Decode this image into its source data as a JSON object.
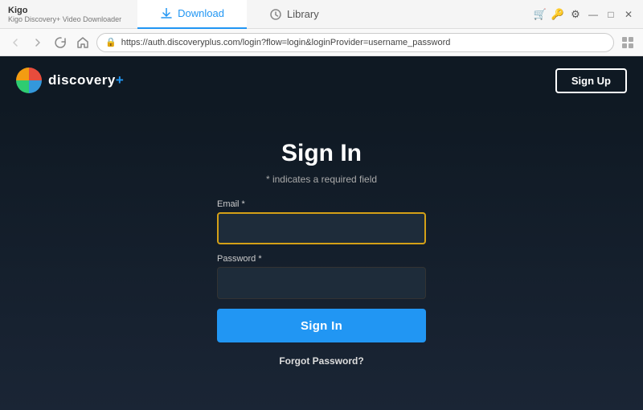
{
  "titlebar": {
    "app_name": "Kigo",
    "app_subtitle": "Kigo Discovery+ Video Downloader",
    "tabs": [
      {
        "id": "download",
        "label": "Download",
        "icon": "download-icon",
        "active": true
      },
      {
        "id": "library",
        "label": "Library",
        "icon": "clock-icon",
        "active": false
      }
    ],
    "controls": {
      "cart_icon": "🛒",
      "bookmark_icon": "🔑",
      "settings_icon": "⚙",
      "minimize": "—",
      "maximize": "□",
      "close": "✕"
    }
  },
  "addressbar": {
    "url": "https://auth.discoveryplus.com/login?flow=login&loginProvider=username_password",
    "lock_icon": "🔒"
  },
  "header": {
    "logo_text": "discovery",
    "logo_plus": "+",
    "signup_label": "Sign Up"
  },
  "signin": {
    "title": "Sign In",
    "required_note": "* indicates a required field",
    "email_label": "Email *",
    "email_placeholder": "",
    "password_label": "Password *",
    "password_placeholder": "",
    "submit_label": "Sign In",
    "forgot_label": "Forgot Password?"
  }
}
